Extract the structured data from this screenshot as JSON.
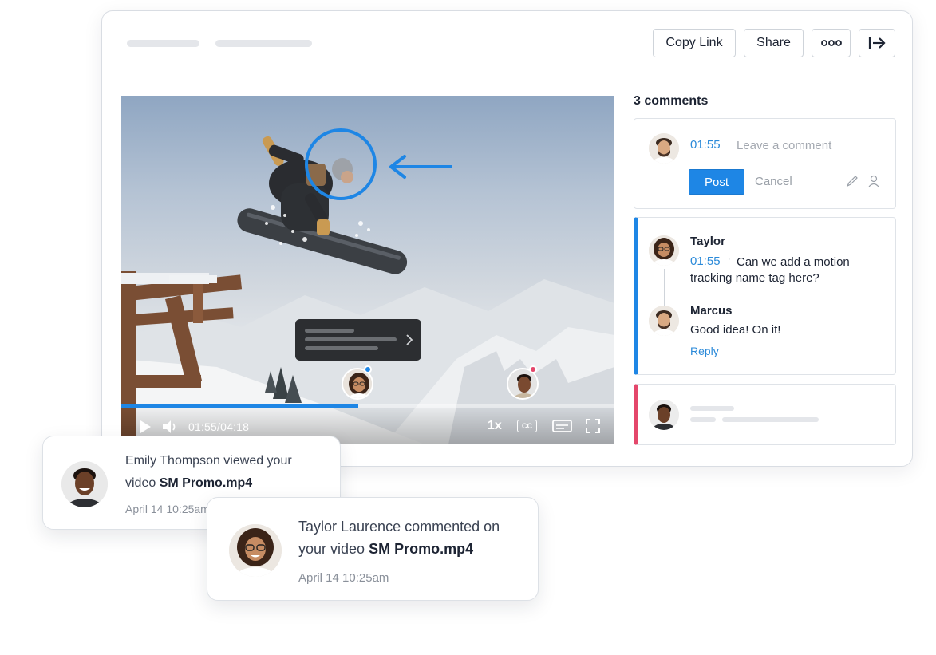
{
  "toolbar": {
    "copy_link_label": "Copy Link",
    "share_label": "Share",
    "more_icon": "ellipsis-icon",
    "exit_icon": "exit-arrow-icon"
  },
  "player": {
    "time_display": "01:55/04:18",
    "speed": "1x",
    "cc_label": "CC",
    "progress_fraction": 0.48
  },
  "comments": {
    "count_label": "3 comments",
    "composer": {
      "timestamp": "01:55",
      "placeholder": "Leave a comment",
      "post_label": "Post",
      "cancel_label": "Cancel"
    },
    "thread": {
      "accent": "#1e86e5",
      "author": "Taylor",
      "timestamp": "01:55",
      "text": "Can we add a motion tracking name tag here?",
      "reply_author": "Marcus",
      "reply_text": "Good idea! On it!",
      "reply_label": "Reply"
    },
    "third_accent": "#e4476b"
  },
  "notifications": [
    {
      "prefix": "Emily Thompson viewed your video ",
      "file": "SM Promo.mp4",
      "date": "April 14 10:25am"
    },
    {
      "prefix": "Taylor Laurence commented on your video ",
      "file": "SM Promo.mp4",
      "date": "April 14 10:25am"
    }
  ],
  "colors": {
    "primary": "#1e86e5",
    "pink_marker": "#e4476b"
  }
}
